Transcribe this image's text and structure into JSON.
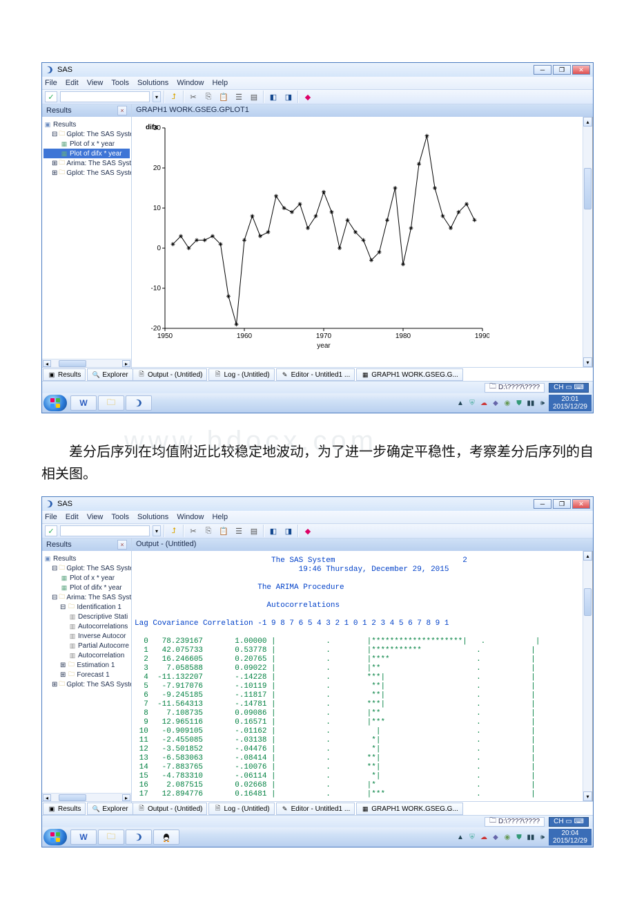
{
  "app_title": "SAS",
  "menu": {
    "file": "File",
    "edit": "Edit",
    "view": "View",
    "tools": "Tools",
    "solutions": "Solutions",
    "window": "Window",
    "help": "Help"
  },
  "results_pane_title": "Results",
  "results_root": "Results",
  "tree1": {
    "gplot_sys": "Gplot:  The SAS System",
    "plot_x_year": "Plot of x * year",
    "plot_difx_year": "Plot of difx * year",
    "arima_sys": "Arima:  The SAS System",
    "gplot_sys2": "Gplot:  The SAS System"
  },
  "tree2": {
    "gplot_sys": "Gplot:  The SAS System",
    "plot_x_year": "Plot of x * year",
    "plot_difx_year": "Plot of difx * year",
    "arima_sys": "Arima:  The SAS System",
    "ident1": "Identification 1",
    "desc_stat": "Descriptive Stati",
    "autocorr": "Autocorrelations",
    "inv_autocorr": "Inverse Autocor",
    "partial_autocorr": "Partial Autocorre",
    "autocorr2": "Autocorrelation",
    "est1": "Estimation 1",
    "fcst1": "Forecast 1",
    "gplot_sys2": "Gplot:  The SAS System"
  },
  "bottom_tabs": {
    "results": "Results",
    "explorer": "Explorer"
  },
  "win_tabs": {
    "output": "Output - (Untitled)",
    "log": "Log - (Untitled)",
    "editor": "Editor - Untitled1 ...",
    "graph": "GRAPH1  WORK.GSEG.G..."
  },
  "graph_header": "GRAPH1  WORK.GSEG.GPLOT1",
  "output_header": "Output - (Untitled)",
  "status_path": "D:\\????\\????",
  "clock1": {
    "time": "20:01",
    "date": "2015/12/29"
  },
  "clock2": {
    "time": "20:04",
    "date": "2015/12/29"
  },
  "paragraph_text": "差分后序列在均值附近比较稳定地波动，为了进一步确定平稳性，考察差分后序列的自相关图。",
  "watermark": "www.bdocx.com",
  "chart_data": {
    "type": "line",
    "ylabel": "difx",
    "xlabel": "year",
    "xticks": [
      1950,
      1960,
      1970,
      1980,
      1990
    ],
    "yticks": [
      -20,
      -10,
      0,
      10,
      20,
      30
    ],
    "series": [
      {
        "name": "difx",
        "points": [
          [
            1951,
            1
          ],
          [
            1952,
            3
          ],
          [
            1953,
            0
          ],
          [
            1954,
            2
          ],
          [
            1955,
            2
          ],
          [
            1956,
            3
          ],
          [
            1957,
            1
          ],
          [
            1958,
            -12
          ],
          [
            1959,
            -19
          ],
          [
            1960,
            2
          ],
          [
            1961,
            8
          ],
          [
            1962,
            3
          ],
          [
            1963,
            4
          ],
          [
            1964,
            13
          ],
          [
            1965,
            10
          ],
          [
            1966,
            9
          ],
          [
            1967,
            11
          ],
          [
            1968,
            5
          ],
          [
            1969,
            8
          ],
          [
            1970,
            14
          ],
          [
            1971,
            9
          ],
          [
            1972,
            0
          ],
          [
            1973,
            7
          ],
          [
            1974,
            4
          ],
          [
            1975,
            2
          ],
          [
            1976,
            -3
          ],
          [
            1977,
            -1
          ],
          [
            1978,
            7
          ],
          [
            1979,
            15
          ],
          [
            1980,
            -4
          ],
          [
            1981,
            5
          ],
          [
            1982,
            21
          ],
          [
            1983,
            28
          ],
          [
            1984,
            15
          ],
          [
            1985,
            8
          ],
          [
            1986,
            5
          ],
          [
            1987,
            9
          ],
          [
            1988,
            11
          ],
          [
            1989,
            7
          ]
        ]
      }
    ]
  },
  "output_text": {
    "sys_title": "The SAS System",
    "sys_page": "2",
    "sys_date": "19:46 Thursday, December 29, 2015",
    "proc_title": "The ARIMA Procedure",
    "section": "Autocorrelations",
    "col_hdr": "Lag Covariance Correlation -1 9 8 7 6 5 4 3 2 1 0 1 2 3 4 5 6 7 8 9 1",
    "rows": [
      {
        "lag": "0",
        "cov": "78.239167",
        "corr": "1.00000",
        "bar": "|********************|"
      },
      {
        "lag": "1",
        "cov": "42.075733",
        "corr": "0.53778",
        "bar": "|***********         "
      },
      {
        "lag": "2",
        "cov": "16.246605",
        "corr": "0.20765",
        "bar": "|****                "
      },
      {
        "lag": "3",
        "cov": "7.058588",
        "corr": "0.09022",
        "bar": "|**                  "
      },
      {
        "lag": "4",
        "cov": "-11.132207",
        "corr": "-.14228",
        "bar": "***|                 "
      },
      {
        "lag": "5",
        "cov": "-7.917076",
        "corr": "-.10119",
        "bar": " **|                 "
      },
      {
        "lag": "6",
        "cov": "-9.245185",
        "corr": "-.11817",
        "bar": " **|                 "
      },
      {
        "lag": "7",
        "cov": "-11.564313",
        "corr": "-.14781",
        "bar": "***|                 "
      },
      {
        "lag": "8",
        "cov": "7.108735",
        "corr": "0.09086",
        "bar": "|**                  "
      },
      {
        "lag": "9",
        "cov": "12.965116",
        "corr": "0.16571",
        "bar": "|***                 "
      },
      {
        "lag": "10",
        "cov": "-0.909105",
        "corr": "-.01162",
        "bar": "  |                  "
      },
      {
        "lag": "11",
        "cov": "-2.455085",
        "corr": "-.03138",
        "bar": " *|                  "
      },
      {
        "lag": "12",
        "cov": "-3.501852",
        "corr": "-.04476",
        "bar": " *|                  "
      },
      {
        "lag": "13",
        "cov": "-6.583063",
        "corr": "-.08414",
        "bar": "**|                  "
      },
      {
        "lag": "14",
        "cov": "-7.883765",
        "corr": "-.10076",
        "bar": "**|                  "
      },
      {
        "lag": "15",
        "cov": "-4.783310",
        "corr": "-.06114",
        "bar": " *|                  "
      },
      {
        "lag": "16",
        "cov": "2.087515",
        "corr": "0.02668",
        "bar": "|*                   "
      },
      {
        "lag": "17",
        "cov": "12.894776",
        "corr": "0.16481",
        "bar": "|***                 "
      }
    ]
  }
}
